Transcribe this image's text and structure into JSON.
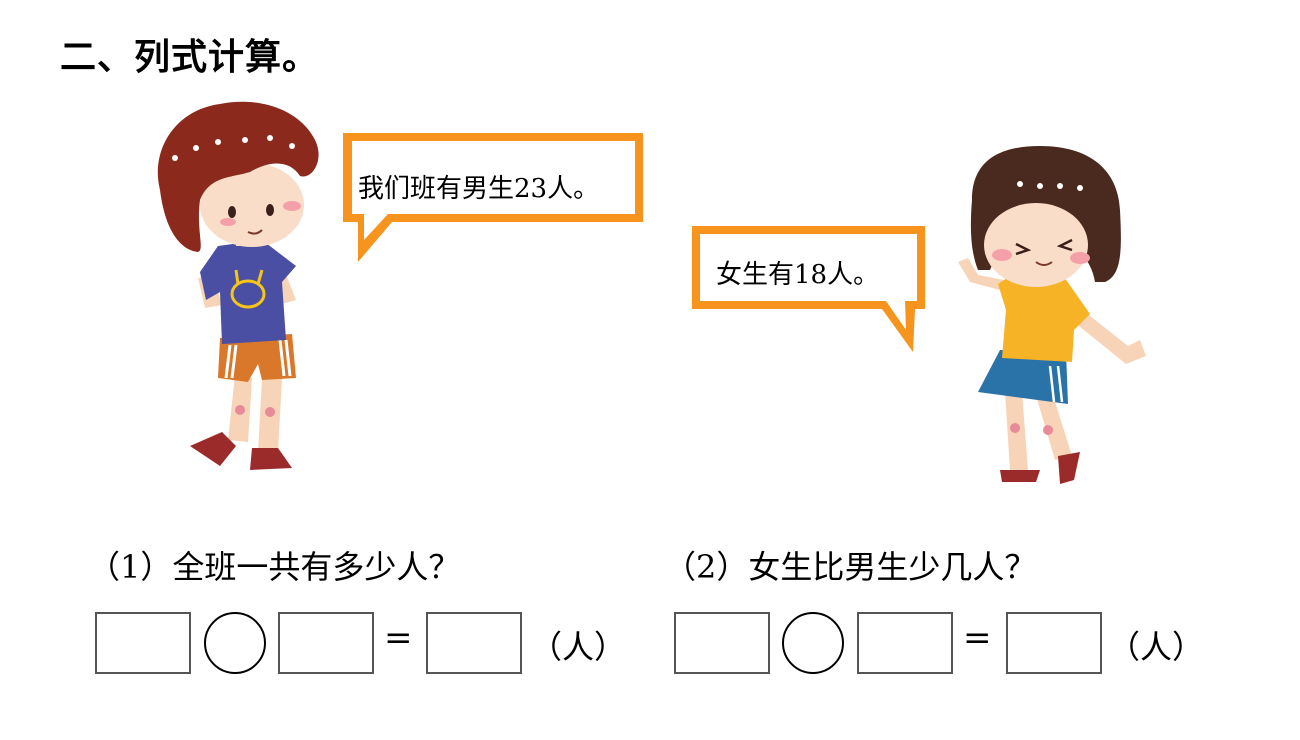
{
  "title": "二、列式计算。",
  "bubbles": {
    "boy": "我们班有男生23人。",
    "girl": "女生有18人。"
  },
  "questions": [
    {
      "text": "（1）全班一共有多少人？",
      "equals": "=",
      "unit": "（人）"
    },
    {
      "text": "（2）女生比男生少几人？",
      "equals": "=",
      "unit": "（人）"
    }
  ],
  "colors": {
    "bubble_border": "#f7941d",
    "boy_hair": "#8b2a1c",
    "boy_shirt": "#4a4fa3",
    "girl_shirt": "#f5b325",
    "girl_skirt": "#2a73a8"
  }
}
